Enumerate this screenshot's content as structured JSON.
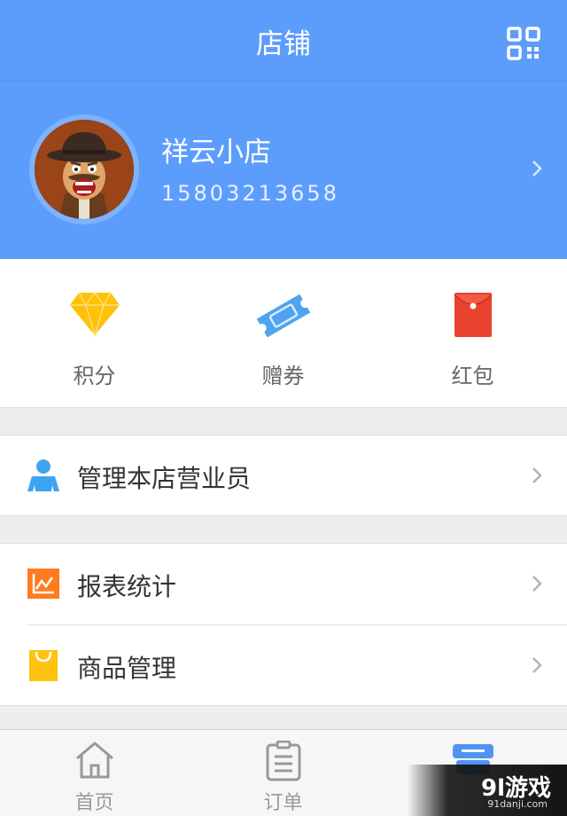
{
  "header": {
    "title": "店铺",
    "qr_icon": "qr-code-icon"
  },
  "profile": {
    "shop_name": "祥云小店",
    "phone": "15803213658",
    "avatar_icon": "cowboy-avatar"
  },
  "benefits": [
    {
      "label": "积分",
      "icon": "diamond-icon",
      "color": "#ffc107"
    },
    {
      "label": "赠券",
      "icon": "ticket-icon",
      "color": "#4fa3ef"
    },
    {
      "label": "红包",
      "icon": "red-envelope-icon",
      "color": "#e8432e"
    }
  ],
  "menu": {
    "staff": {
      "label": "管理本店营业员",
      "icon": "person-icon",
      "color": "#3fa4f0"
    },
    "reports": {
      "label": "报表统计",
      "icon": "chart-icon",
      "color": "#ff7c1e"
    },
    "products": {
      "label": "商品管理",
      "icon": "shopping-bag-icon",
      "color": "#ffc20e"
    }
  },
  "tabbar": {
    "items": [
      {
        "label": "首页",
        "icon": "home-icon",
        "active": false
      },
      {
        "label": "订单",
        "icon": "clipboard-icon",
        "active": false
      },
      {
        "label": "",
        "icon": "store-icon",
        "active": true
      }
    ],
    "active_color": "#4f94f5",
    "inactive_color": "#999999"
  },
  "watermark": {
    "main": "9l游戏",
    "sub": "91danji.com"
  }
}
